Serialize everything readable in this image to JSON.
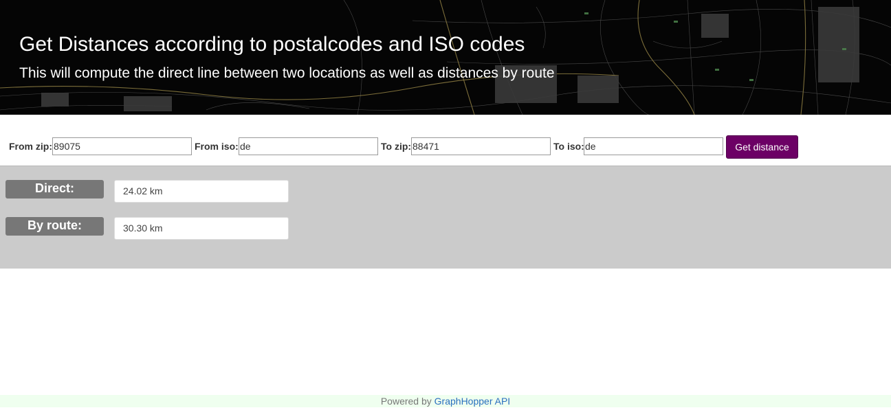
{
  "header": {
    "title": "Get Distances according to postalcodes and ISO codes",
    "subtitle": "This will compute the direct line between two locations as well as distances by route"
  },
  "form": {
    "from_zip": {
      "label": "From zip:",
      "value": "89075"
    },
    "from_iso": {
      "label": "From iso:",
      "value": "de"
    },
    "to_zip": {
      "label": "To zip:",
      "value": "88471"
    },
    "to_iso": {
      "label": "To iso:",
      "value": "de"
    },
    "submit_label": "Get distance"
  },
  "results": {
    "direct": {
      "label": "Direct:",
      "value": "24.02 km"
    },
    "by_route": {
      "label": "By route:",
      "value": "30.30 km"
    }
  },
  "footer": {
    "prefix": "Powered by",
    "link_text": "GraphHopper API"
  },
  "colors": {
    "button": "#6c0065",
    "results_bg": "#cbcbcb",
    "label_bg": "#777777",
    "footer_bg": "#efffef",
    "link": "#2a6fbf"
  }
}
